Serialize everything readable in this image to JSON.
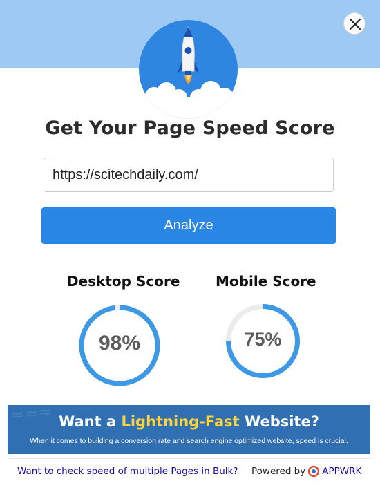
{
  "header": {
    "title": "Get Your Page Speed Score"
  },
  "form": {
    "url_value": "https://scitechdaily.com/",
    "analyze_label": "Analyze"
  },
  "scores": {
    "desktop": {
      "label": "Desktop Score",
      "value": 98,
      "text": "98%"
    },
    "mobile": {
      "label": "Mobile Score",
      "value": 75,
      "text": "75%"
    }
  },
  "promo": {
    "title_prefix": "Want a ",
    "title_highlight": "Lightning-Fast",
    "title_suffix": " Website?",
    "subtitle": "When it comes to building a conversion rate and search engine optimized website, speed is crucial."
  },
  "footer": {
    "bulk_link": "Want to check speed of multiple Pages in Bulk?",
    "powered_by": "Powered by",
    "brand": "APPWRK"
  },
  "colors": {
    "accent": "#2a86e4",
    "gauge_fill": "#3d98e5",
    "gauge_track": "#ececec",
    "header_band": "#9ec9f2",
    "highlight": "#ffd23f"
  },
  "icons": {
    "close": "close-icon",
    "rocket": "rocket-icon",
    "brand_logo": "appwrk-logo-icon"
  }
}
